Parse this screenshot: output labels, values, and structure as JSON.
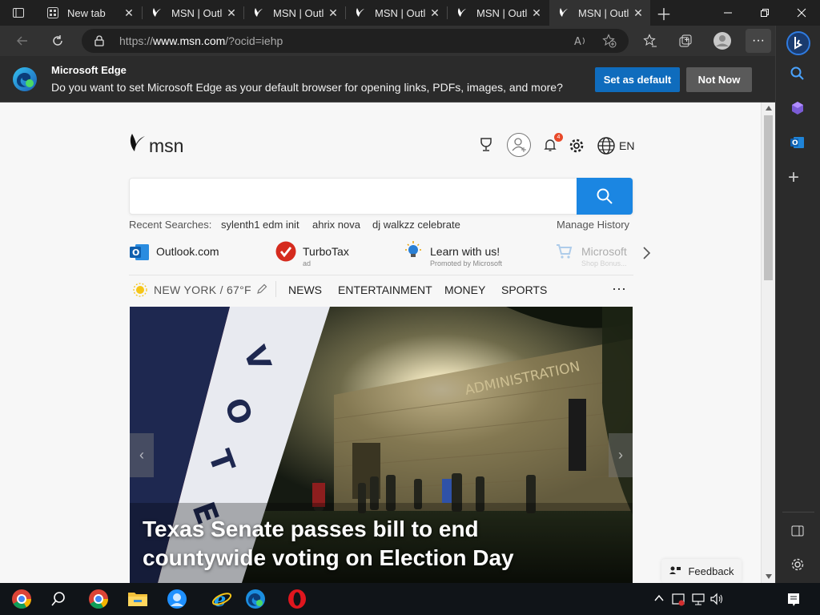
{
  "tabs": [
    {
      "title": "New tab",
      "active": false
    },
    {
      "title": "MSN | Outlo",
      "active": false
    },
    {
      "title": "MSN | Outlo",
      "active": false
    },
    {
      "title": "MSN | Outlo",
      "active": false
    },
    {
      "title": "MSN | Outlo",
      "active": false
    },
    {
      "title": "MSN | Outlo",
      "active": true
    }
  ],
  "address": {
    "prefix": "https://",
    "host": "www.msn.com",
    "path": "/?ocid=iehp"
  },
  "infobar": {
    "title": "Microsoft Edge",
    "message": "Do you want to set Microsoft Edge as your default browser for opening links, PDFs, images, and more?",
    "primary_label": "Set as default",
    "secondary_label": "Not Now"
  },
  "msn": {
    "logo_text": "msn",
    "language": "EN",
    "notification_count": "4",
    "search_value": "",
    "recent_label": "Recent Searches:",
    "recent_searches": [
      "sylenth1 edm init",
      "ahrix nova",
      "dj walkzz celebrate"
    ],
    "manage_history": "Manage History",
    "quick_links": [
      {
        "label": "Outlook.com",
        "sub": ""
      },
      {
        "label": "TurboTax",
        "sub": "ad"
      },
      {
        "label": "Learn with us!",
        "sub": "Promoted by Microsoft"
      },
      {
        "label": "Microsoft",
        "sub": "Shop Bonus..."
      }
    ],
    "weather": "NEW YORK / 67°F",
    "nav": [
      "NEWS",
      "ENTERTAINMENT",
      "MONEY",
      "SPORTS"
    ],
    "more": "···",
    "hero_title": "Texas Senate passes bill to end countywide voting on Election Day",
    "hero_sign_text": "ADMINISTRATION",
    "feedback": "Feedback"
  },
  "colors": {
    "accent": "#1b86e2",
    "edge_blue": "#0f6cbd"
  }
}
